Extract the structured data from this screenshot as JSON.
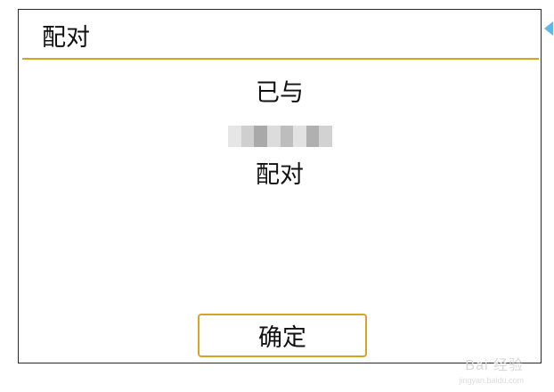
{
  "dialog": {
    "title": "配对",
    "message_line1": "已与",
    "message_line3": "配对",
    "device_name_obscured": true,
    "ok_label": "确定"
  },
  "watermark": {
    "brand": "Bai 经验",
    "url": "jingyan.baidu.com"
  },
  "colors": {
    "accent": "#d4a422",
    "text": "#111111",
    "background": "#ffffff",
    "corner_marker": "#5fb8e8"
  }
}
